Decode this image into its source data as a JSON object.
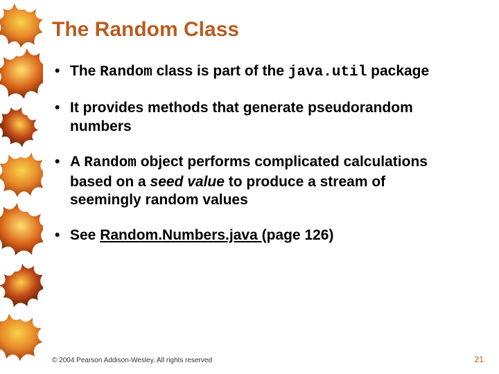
{
  "title": "The Random Class",
  "bullets": [
    {
      "pre": "The ",
      "code1": "Random",
      "mid": " class is part of the ",
      "code2": "java.util",
      "post": " package"
    },
    {
      "full": "It provides methods that generate pseudorandom numbers"
    },
    {
      "pre": "A ",
      "code1": "Random",
      "mid": " object performs complicated calculations based on a ",
      "em": "seed value",
      "post": " to produce a stream of seemingly random values"
    },
    {
      "pre": "See ",
      "link": "Random.Numbers.java ",
      "post": "(page 126)"
    }
  ],
  "footer": {
    "copyright": "© 2004 Pearson Addison-Wesley. All rights reserved",
    "page": "21"
  }
}
